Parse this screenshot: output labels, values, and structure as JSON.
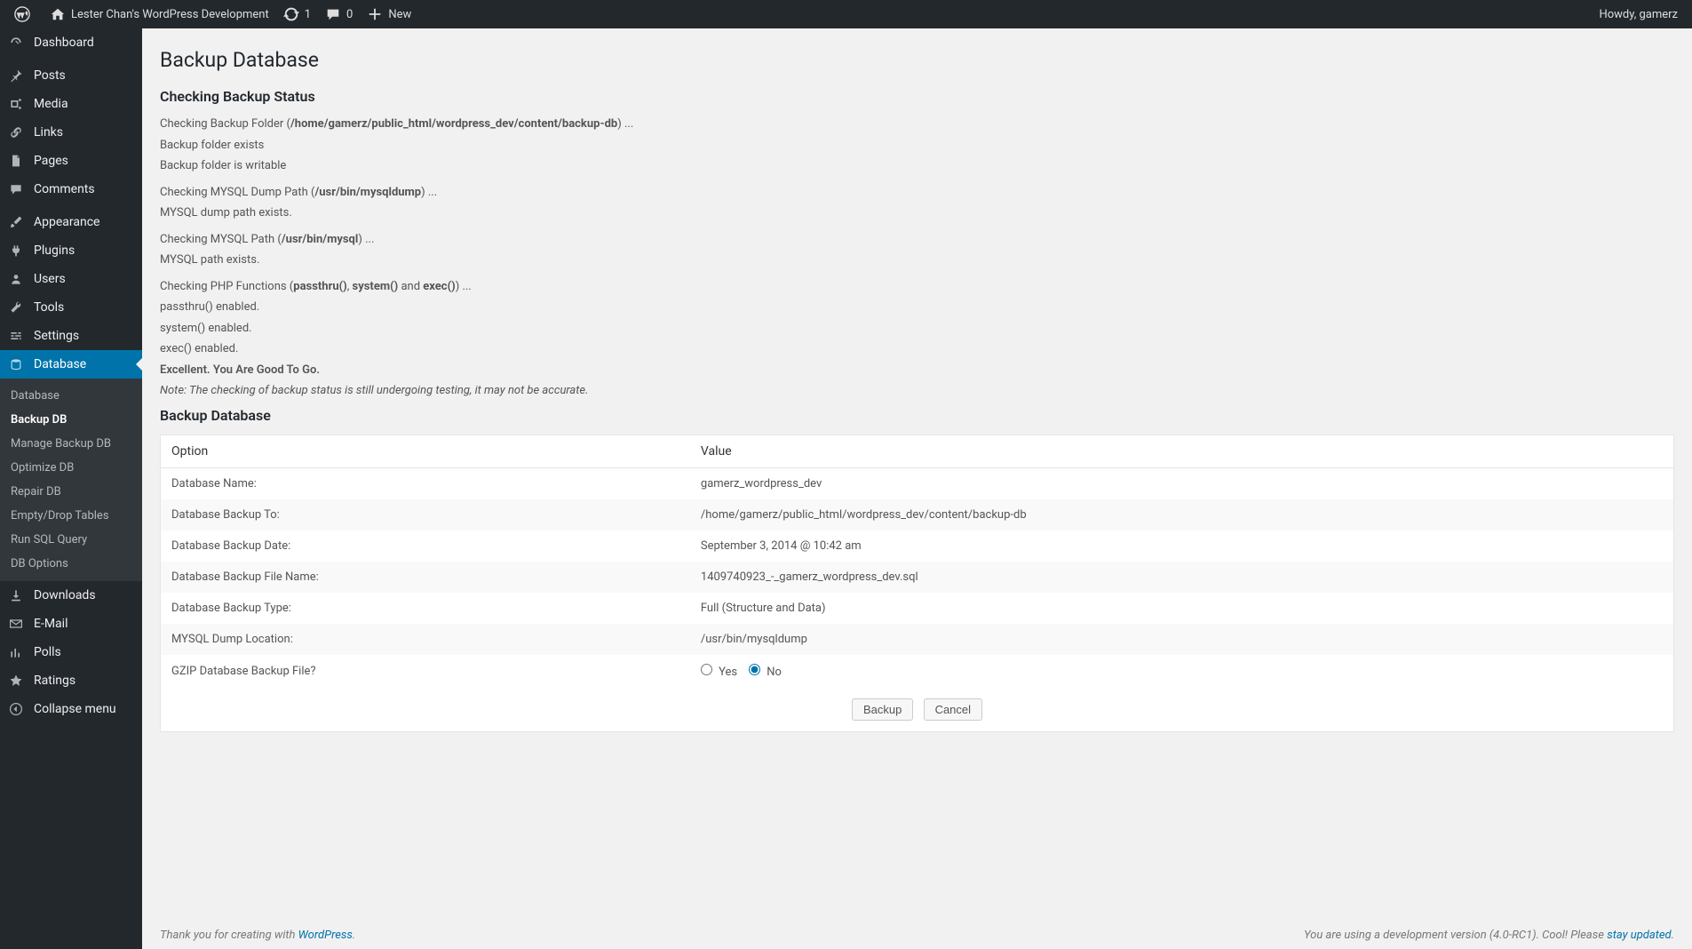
{
  "adminbar": {
    "site_title": "Lester Chan's WordPress Development",
    "updates_count": "1",
    "comments_count": "0",
    "new_label": "New",
    "howdy": "Howdy, gamerz"
  },
  "sidebar": {
    "items": [
      {
        "label": "Dashboard",
        "icon": "dashboard"
      },
      {
        "label": "Posts",
        "icon": "pin"
      },
      {
        "label": "Media",
        "icon": "media"
      },
      {
        "label": "Links",
        "icon": "link"
      },
      {
        "label": "Pages",
        "icon": "page"
      },
      {
        "label": "Comments",
        "icon": "comment"
      },
      {
        "label": "Appearance",
        "icon": "brush"
      },
      {
        "label": "Plugins",
        "icon": "plug"
      },
      {
        "label": "Users",
        "icon": "users"
      },
      {
        "label": "Tools",
        "icon": "wrench"
      },
      {
        "label": "Settings",
        "icon": "sliders"
      },
      {
        "label": "Database",
        "icon": "database"
      },
      {
        "label": "Downloads",
        "icon": "download"
      },
      {
        "label": "E-Mail",
        "icon": "mail"
      },
      {
        "label": "Polls",
        "icon": "chart"
      },
      {
        "label": "Ratings",
        "icon": "star"
      },
      {
        "label": "Collapse menu",
        "icon": "collapse"
      }
    ],
    "submenu": [
      "Database",
      "Backup DB",
      "Manage Backup DB",
      "Optimize DB",
      "Repair DB",
      "Empty/Drop Tables",
      "Run SQL Query",
      "DB Options"
    ],
    "submenu_current": "Backup DB"
  },
  "page": {
    "title": "Backup Database",
    "status_heading": "Checking Backup Status",
    "backup_heading": "Backup Database",
    "radio_yes": "Yes",
    "radio_no": "No",
    "btn_backup": "Backup",
    "btn_cancel": "Cancel"
  },
  "status": {
    "l1a": "Checking Backup Folder (",
    "l1b": "/home/gamerz/public_html/wordpress_dev/content/backup-db",
    "l1c": ") ...",
    "l1_ok1": "Backup folder exists",
    "l1_ok2": "Backup folder is writable",
    "l2a": "Checking MYSQL Dump Path (",
    "l2b": "/usr/bin/mysqldump",
    "l2c": ") ...",
    "l2_ok1": "MYSQL dump path exists.",
    "l3a": "Checking MYSQL Path (",
    "l3b": "/usr/bin/mysql",
    "l3c": ") ...",
    "l3_ok1": "MYSQL path exists.",
    "l4a": "Checking PHP Functions (",
    "l4b": "passthru()",
    "l4c": ", ",
    "l4d": "system()",
    "l4e": " and ",
    "l4f": "exec()",
    "l4g": ") ...",
    "l4_ok1": "passthru() enabled.",
    "l4_ok2": "system() enabled.",
    "l4_ok3": "exec() enabled.",
    "excellent": "Excellent. You Are Good To Go.",
    "note": "Note: The checking of backup status is still undergoing testing, it may not be accurate."
  },
  "table": {
    "head_option": "Option",
    "head_value": "Value",
    "rows": [
      {
        "k": "Database Name:",
        "v": "gamerz_wordpress_dev"
      },
      {
        "k": "Database Backup To:",
        "v": "/home/gamerz/public_html/wordpress_dev/content/backup-db"
      },
      {
        "k": "Database Backup Date:",
        "v": "September 3, 2014 @ 10:42 am"
      },
      {
        "k": "Database Backup File Name:",
        "v": "1409740923_-_gamerz_wordpress_dev.sql"
      },
      {
        "k": "Database Backup Type:",
        "v": "Full (Structure and Data)"
      },
      {
        "k": "MYSQL Dump Location:",
        "v": "/usr/bin/mysqldump"
      },
      {
        "k": "GZIP Database Backup File?",
        "v": ""
      }
    ]
  },
  "footer": {
    "left_a": "Thank you for creating with ",
    "left_link": "WordPress",
    "left_b": ".",
    "right_a": "You are using a development version (4.0-RC1). Cool! Please ",
    "right_link": "stay updated",
    "right_b": "."
  }
}
